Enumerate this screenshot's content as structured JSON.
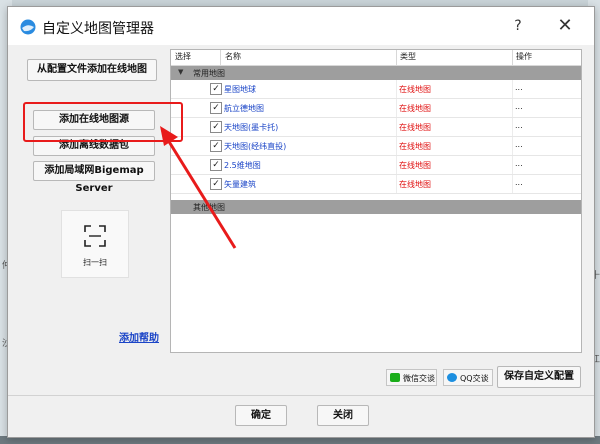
{
  "window": {
    "title": "自定义地图管理器",
    "help": "?",
    "close": "✕"
  },
  "left": {
    "add_from_config": "从配置文件添加在线地图",
    "add_online_source": "添加在线地图源",
    "add_offline_pack": "添加离线数据包",
    "add_lan_server": "添加局域网Bigemap Server",
    "scan": "扫一扫",
    "help_link": "添加帮助"
  },
  "table": {
    "columns": [
      "选择",
      "名称",
      "类型",
      "操作"
    ],
    "groups": [
      {
        "label": "常用地图",
        "rows": [
          {
            "name": "星图地球",
            "type": "在线地图",
            "op": "...",
            "checked": true
          },
          {
            "name": "航立德地图",
            "type": "在线地图",
            "op": "...",
            "checked": true
          },
          {
            "name": "天地图(墨卡托)",
            "type": "在线地图",
            "op": "...",
            "checked": true
          },
          {
            "name": "天地图(经纬直投)",
            "type": "在线地图",
            "op": "...",
            "checked": true
          },
          {
            "name": "2.5维地图",
            "type": "在线地图",
            "op": "...",
            "checked": true
          },
          {
            "name": "矢量建筑",
            "type": "在线地图",
            "op": "...",
            "checked": true
          }
        ]
      },
      {
        "label": "其他地图",
        "rows": []
      }
    ]
  },
  "share": {
    "wechat": "微信交谈",
    "qq": "QQ交谈",
    "save": "保存自定义配置"
  },
  "footer": {
    "ok": "确定",
    "close": "关闭"
  },
  "background": {
    "glyphs": [
      "仲",
      "沙",
      "十",
      "江"
    ]
  },
  "colors": {
    "accent": "#1a44c7",
    "highlight": "#e81b1b",
    "type_text": "#e01010",
    "group_bg": "#9e9e9e"
  }
}
